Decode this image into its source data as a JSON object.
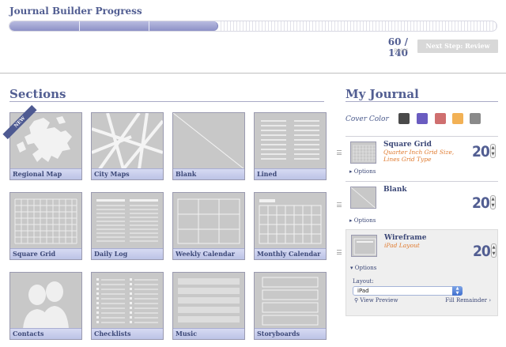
{
  "progress": {
    "title": "Journal Builder Progress",
    "current": 60,
    "total": 140,
    "count_text": "60 / 140",
    "unit": "pages",
    "fraction": 0.4286,
    "next_label": "Next Step: Review"
  },
  "sections": {
    "title": "Sections",
    "new_badge": "NEW",
    "tiles": [
      {
        "label": "Regional Map",
        "icon": "map-icon"
      },
      {
        "label": "City Maps",
        "icon": "street-map-icon"
      },
      {
        "label": "Blank",
        "icon": "blank-page-icon"
      },
      {
        "label": "Lined",
        "icon": "lined-page-icon"
      },
      {
        "label": "Square Grid",
        "icon": "grid-page-icon"
      },
      {
        "label": "Daily Log",
        "icon": "daily-log-icon"
      },
      {
        "label": "Weekly Calendar",
        "icon": "weekly-calendar-icon"
      },
      {
        "label": "Monthly Calendar",
        "icon": "monthly-calendar-icon"
      },
      {
        "label": "Contacts",
        "icon": "contacts-icon"
      },
      {
        "label": "Checklists",
        "icon": "checklist-icon"
      },
      {
        "label": "Music",
        "icon": "music-staff-icon"
      },
      {
        "label": "Storyboards",
        "icon": "storyboard-icon"
      }
    ]
  },
  "journal": {
    "title": "My Journal",
    "cover_label": "Cover Color",
    "cover_colors": [
      "#4a4a4a",
      "#6a5cc0",
      "#cf6f6f",
      "#f2b155",
      "#8a8a8a"
    ],
    "items": [
      {
        "name": "Square Grid",
        "subtitle": "Quarter Inch Grid Size, Lines Grid Type",
        "count": "20",
        "options": "▸ Options"
      },
      {
        "name": "Blank",
        "subtitle": "",
        "count": "20",
        "options": "▸ Options"
      },
      {
        "name": "Wireframe",
        "subtitle": "iPad Layout",
        "count": "20",
        "options": "▾ Options"
      }
    ],
    "layout_label": "Layout:",
    "layout_value": "iPad",
    "view_preview": "View Preview",
    "fill_remainder": "Fill Remainder"
  }
}
